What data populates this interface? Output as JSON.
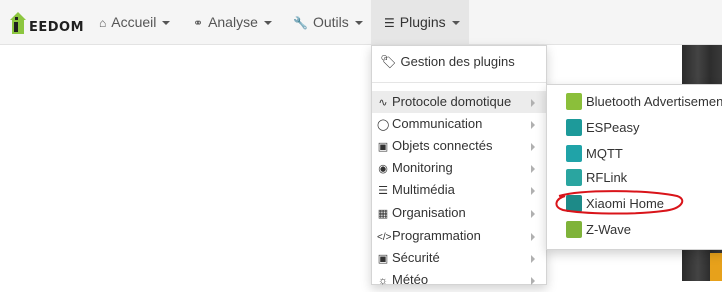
{
  "app": {
    "logo_text": "EEDOM"
  },
  "navbar": {
    "items": [
      {
        "label": "Accueil",
        "icon": "home-icon"
      },
      {
        "label": "Analyse",
        "icon": "stethoscope-icon"
      },
      {
        "label": "Outils",
        "icon": "wrench-icon"
      },
      {
        "label": "Plugins",
        "icon": "list-icon",
        "active": true
      }
    ]
  },
  "plugins_menu": {
    "header": "Gestion des plugins",
    "items": [
      {
        "label": "Protocole domotique",
        "icon": "rss-icon",
        "active": true
      },
      {
        "label": "Communication",
        "icon": "comment-icon"
      },
      {
        "label": "Objets connectés",
        "icon": "tv-icon"
      },
      {
        "label": "Monitoring",
        "icon": "tachometer-icon"
      },
      {
        "label": "Multimédia",
        "icon": "sliders-icon"
      },
      {
        "label": "Organisation",
        "icon": "calendar-icon"
      },
      {
        "label": "Programmation",
        "icon": "code-icon"
      },
      {
        "label": "Sécurité",
        "icon": "lock-icon"
      },
      {
        "label": "Météo",
        "icon": "sun-icon"
      }
    ]
  },
  "protocol_submenu": {
    "items": [
      {
        "label": "Bluetooth Advertisement",
        "icon": "bluetooth-plugin-icon",
        "color": "#8bbf3a"
      },
      {
        "label": "ESPeasy",
        "icon": "espeasy-plugin-icon",
        "color": "#1d9a9a"
      },
      {
        "label": "MQTT",
        "icon": "mqtt-plugin-icon",
        "color": "#20a3a8"
      },
      {
        "label": "RFLink",
        "icon": "rflink-plugin-icon",
        "color": "#2aa5a0"
      },
      {
        "label": "Xiaomi Home",
        "icon": "xiaomi-plugin-icon",
        "color": "#1d8a88",
        "highlighted": true
      },
      {
        "label": "Z-Wave",
        "icon": "zwave-plugin-icon",
        "color": "#7fb33a"
      }
    ]
  },
  "colors": {
    "navbar_bg": "#f5f5f5",
    "highlight_circle": "#d9141a"
  }
}
